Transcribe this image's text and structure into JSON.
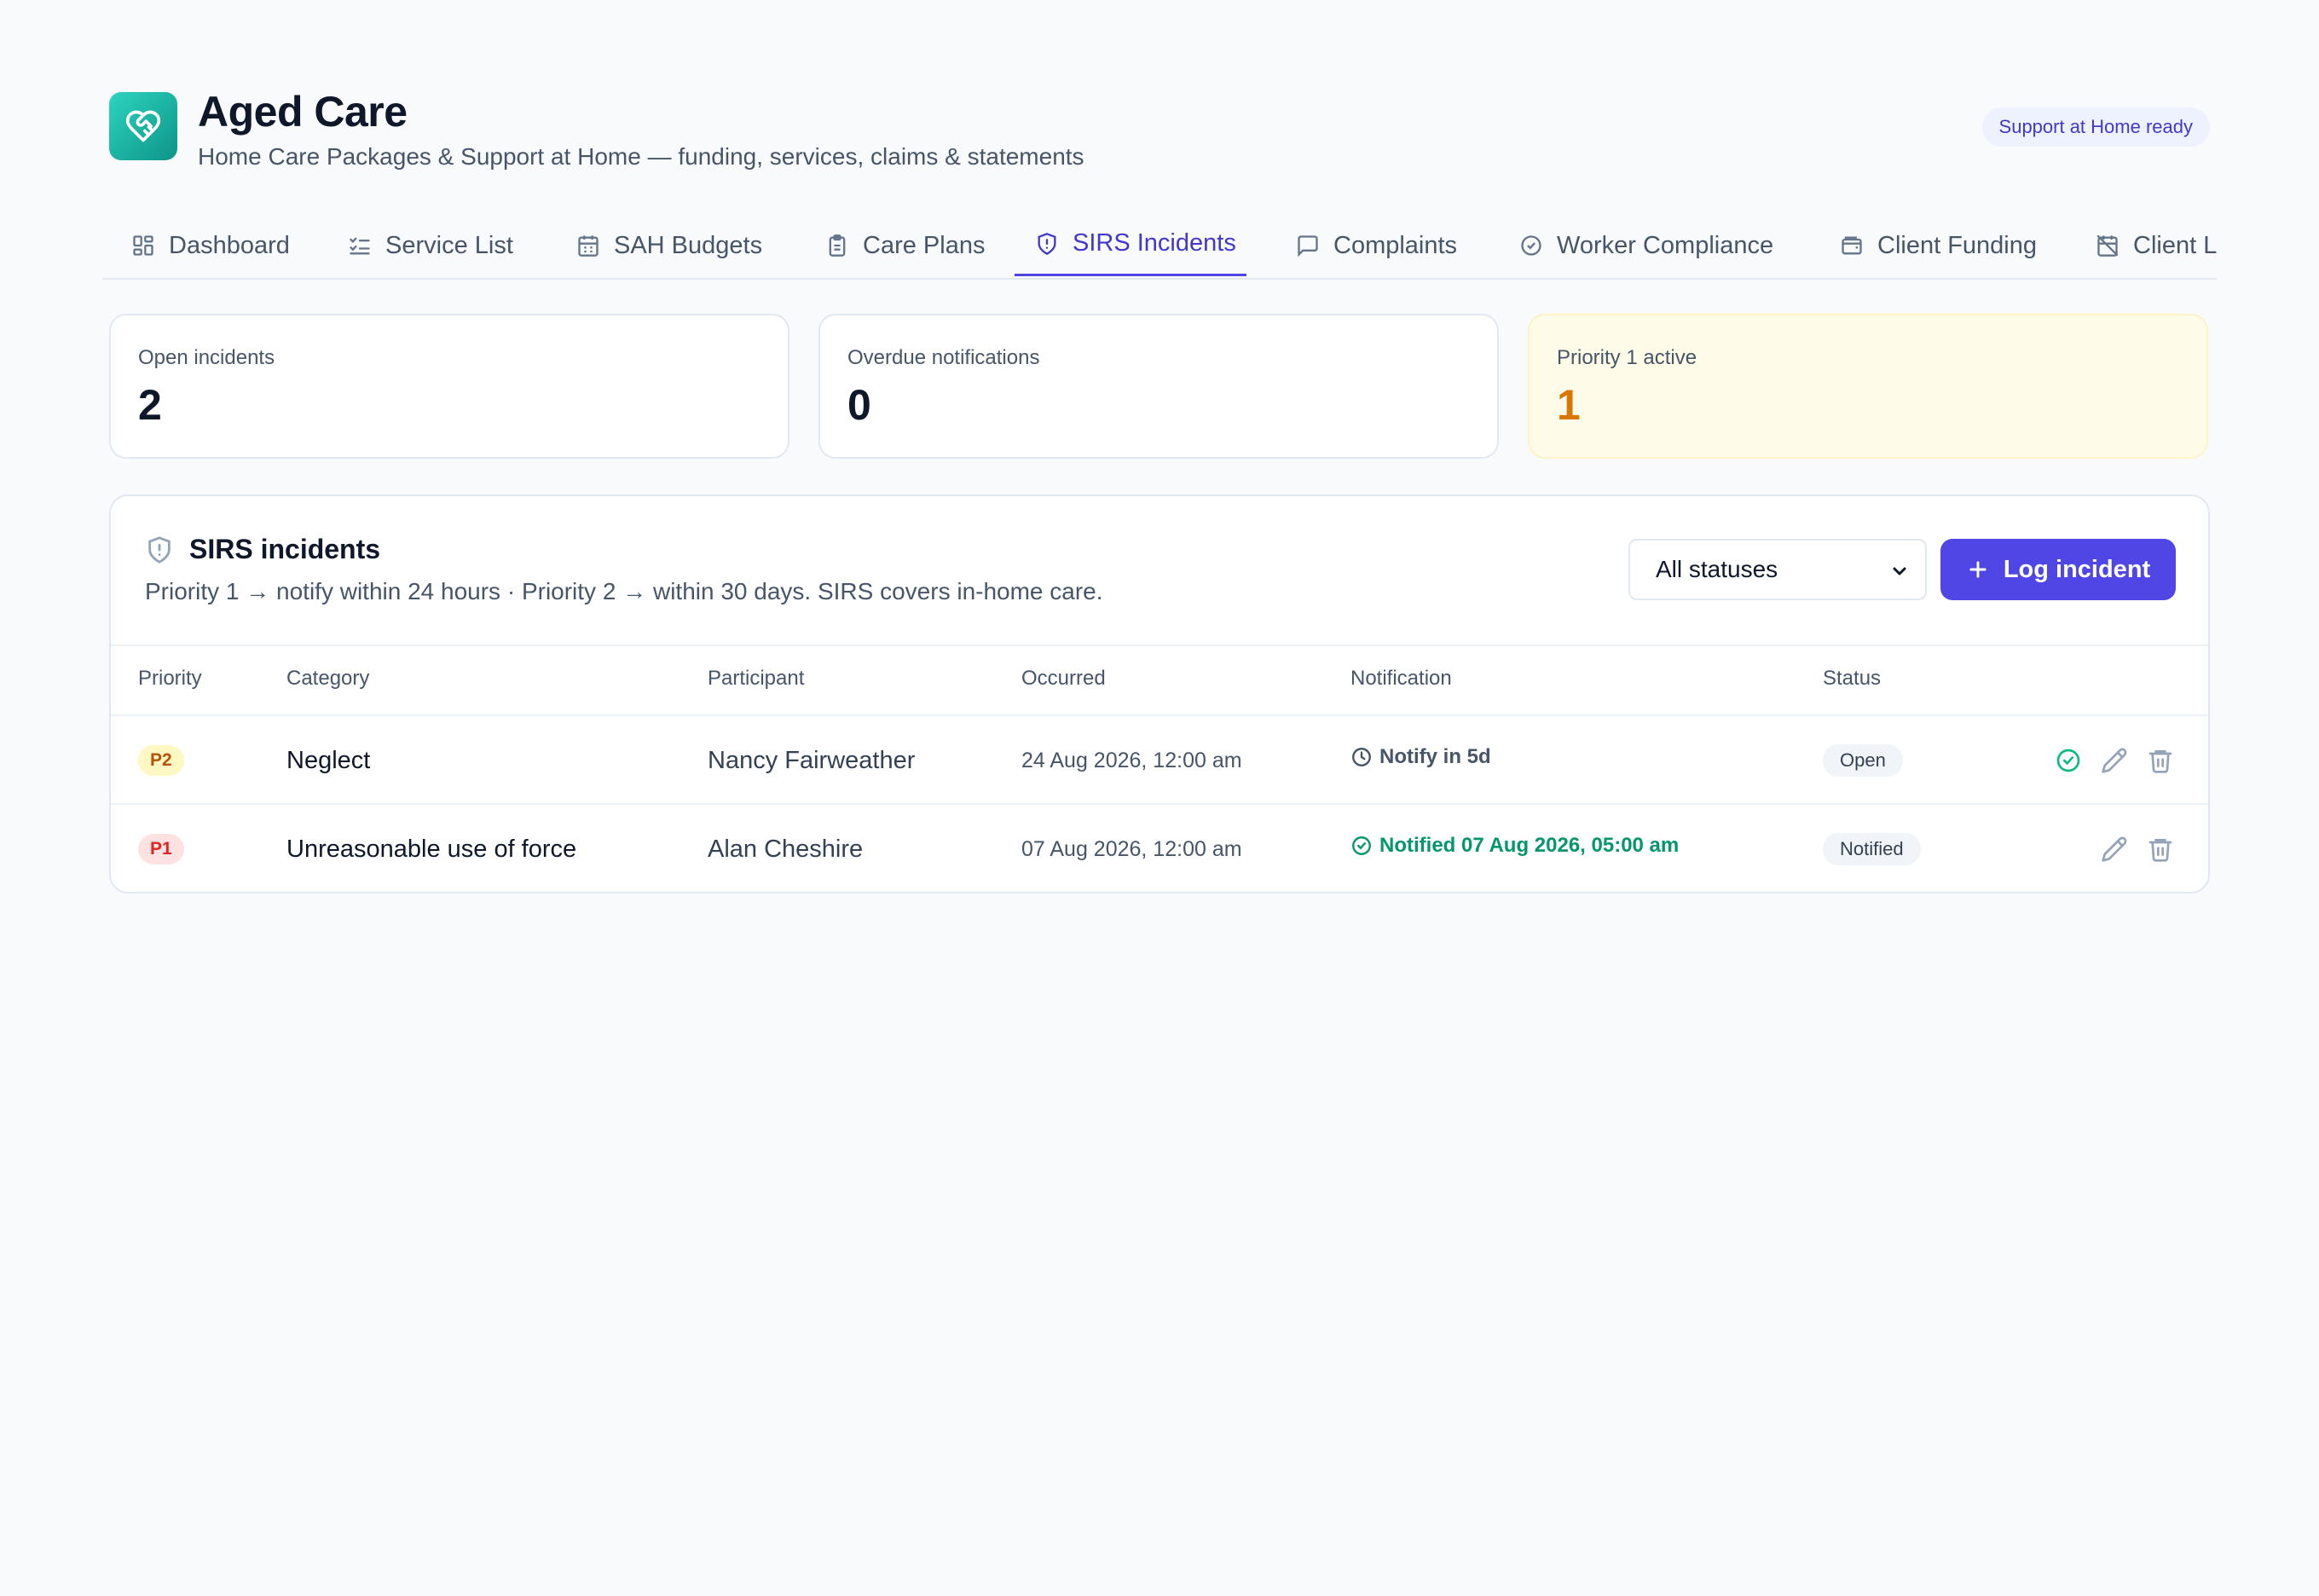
{
  "app": {
    "title": "Aged Care",
    "subtitle": "Home Care Packages & Support at Home — funding, services, claims & statements",
    "badge": "Support at Home ready",
    "logo_icon": "heart-handshake-icon"
  },
  "tabs": [
    {
      "label": "Dashboard",
      "icon": "dashboard-grid-icon"
    },
    {
      "label": "Service List",
      "icon": "checklist-icon"
    },
    {
      "label": "SAH Budgets",
      "icon": "calendar-icon"
    },
    {
      "label": "Care Plans",
      "icon": "clipboard-icon"
    },
    {
      "label": "SIRS Incidents",
      "icon": "shield-alert-icon",
      "active": true
    },
    {
      "label": "Complaints",
      "icon": "message-icon"
    },
    {
      "label": "Worker Compliance",
      "icon": "check-circle-icon"
    },
    {
      "label": "Client Funding",
      "icon": "wallet-icon"
    },
    {
      "label": "Client L",
      "icon": "calendar-off-icon"
    }
  ],
  "kpis": [
    {
      "label": "Open incidents",
      "value": "2"
    },
    {
      "label": "Overdue notifications",
      "value": "0"
    },
    {
      "label": "Priority 1 active",
      "value": "1",
      "tone": "warning"
    }
  ],
  "incidents": {
    "title": "SIRS incidents",
    "description": "Priority 1 → notify within 24 hours · Priority 2 → within 30 days. SIRS covers in-home care.",
    "filter_value": "All statuses",
    "log_button": "Log incident",
    "columns": [
      "Priority",
      "Category",
      "Participant",
      "Occurred",
      "Notification",
      "Status"
    ],
    "rows": [
      {
        "priority": "P2",
        "category": "Neglect",
        "participant": "Nancy Fairweather",
        "occurred": "24 Aug 2026, 12:00 am",
        "notification": "Notify in 5d",
        "notification_state": "pending",
        "status": "Open",
        "actions": [
          "mark-notified",
          "edit",
          "delete"
        ]
      },
      {
        "priority": "P1",
        "category": "Unreasonable use of force",
        "participant": "Alan Cheshire",
        "occurred": "07 Aug 2026, 12:00 am",
        "notification": "Notified 07 Aug 2026, 05:00 am",
        "notification_state": "done",
        "status": "Notified",
        "actions": [
          "edit",
          "delete"
        ]
      }
    ]
  },
  "colors": {
    "accent": "#4f46e5",
    "teal": "#14b8a6",
    "warning": "#d97706",
    "success": "#059669",
    "danger": "#dc2626"
  }
}
